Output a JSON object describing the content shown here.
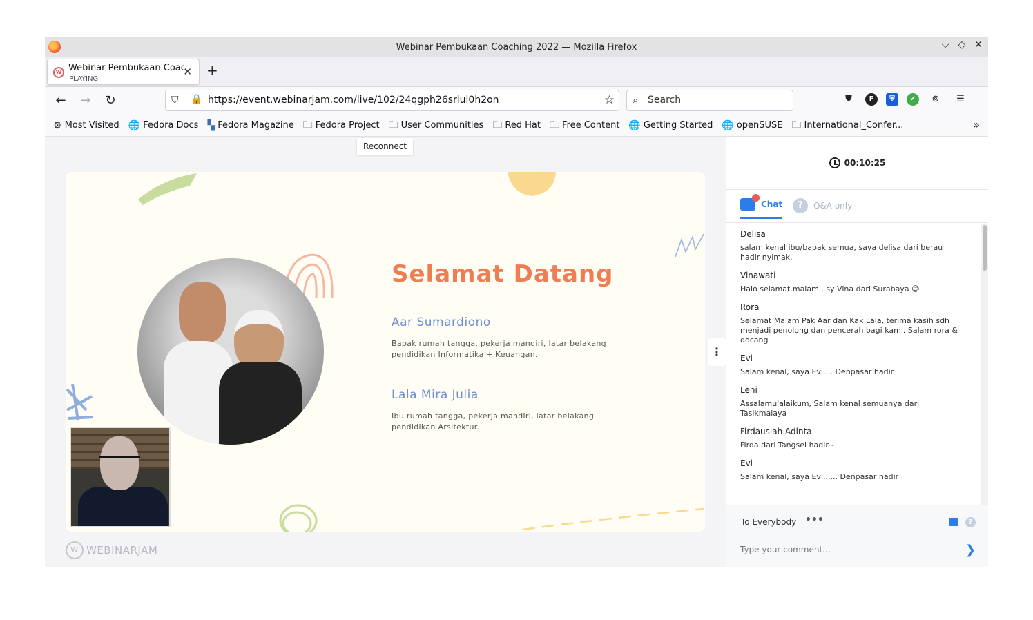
{
  "window": {
    "title": "Webinar Pembukaan Coaching 2022 — Mozilla Firefox",
    "controls": {
      "minimize": "⌵",
      "maximize": "◇",
      "close": "✕"
    }
  },
  "tab": {
    "title": "Webinar Pembukaan Coaching 2022",
    "status": "PLAYING",
    "close": "✕",
    "new_tab": "+"
  },
  "nav": {
    "back": "←",
    "forward": "→",
    "reload": "↻",
    "url": "https://event.webinarjam.com/live/102/24qgph26srlul0h2on",
    "search_placeholder": "Search"
  },
  "bookmarks": [
    {
      "label": "Most Visited",
      "icon": "gear-icon",
      "glyph": "⚙"
    },
    {
      "label": "Fedora Docs",
      "icon": "globe-icon",
      "glyph": "🌐"
    },
    {
      "label": "Fedora Magazine",
      "icon": "magazine-icon",
      "glyph": "▚"
    },
    {
      "label": "Fedora Project",
      "icon": "folder-icon",
      "glyph": "🗀"
    },
    {
      "label": "User Communities",
      "icon": "folder-icon",
      "glyph": "🗀"
    },
    {
      "label": "Red Hat",
      "icon": "folder-icon",
      "glyph": "🗀"
    },
    {
      "label": "Free Content",
      "icon": "folder-icon",
      "glyph": "🗀"
    },
    {
      "label": "Getting Started",
      "icon": "globe-icon",
      "glyph": "🌐"
    },
    {
      "label": "openSUSE",
      "icon": "globe-icon",
      "glyph": "🌐"
    },
    {
      "label": "International_Confer...",
      "icon": "folder-icon",
      "glyph": "🗀"
    }
  ],
  "bookmarks_more": "»",
  "content": {
    "tooltip": "Reconnect",
    "slide": {
      "title": "Selamat Datang",
      "speaker1_name": "Aar Sumardiono",
      "speaker1_desc": "Bapak rumah tangga, pekerja mandiri, latar belakang pendidikan Informatika + Keuangan.",
      "speaker2_name": "Lala Mira Julia",
      "speaker2_desc": "Ibu rumah tangga, pekerja mandiri, latar belakang pendidikan Arsitektur."
    },
    "brand": "WEBINARJAM",
    "brand_logo": "W"
  },
  "panel": {
    "timer": "00:10:25",
    "tab_chat": "Chat",
    "tab_qa": "Q&A only",
    "messages": [
      {
        "name": "Delisa",
        "text": "salam kenal ibu/bapak semua, saya delisa dari berau hadir nyimak."
      },
      {
        "name": "Vinawati",
        "text": "Halo selamat malam.. sy Vina dari Surabaya 😊"
      },
      {
        "name": "Rora",
        "text": "Selamat Malam Pak Aar dan Kak Lala, terima kasih sdh menjadi penolong dan pencerah bagi kami. Salam rora & docang"
      },
      {
        "name": "Evi",
        "text": "Salam kenal, saya Evi.... Denpasar hadir"
      },
      {
        "name": "Leni",
        "text": "Assalamu'alaikum, Salam kenal semuanya dari Tasikmalaya"
      },
      {
        "name": "Firdausiah Adinta",
        "text": "Firda dari Tangsel hadir~"
      },
      {
        "name": "Evi",
        "text": "Salam kenal, saya Evi...... Denpasar hadir"
      }
    ],
    "to": "To Everybody",
    "more": "•••",
    "comment_placeholder": "Type your comment...",
    "send": "❯"
  },
  "colors": {
    "accent": "#2b7de9",
    "slide_title": "#ee7d54",
    "speaker_name": "#6b8fcf"
  }
}
